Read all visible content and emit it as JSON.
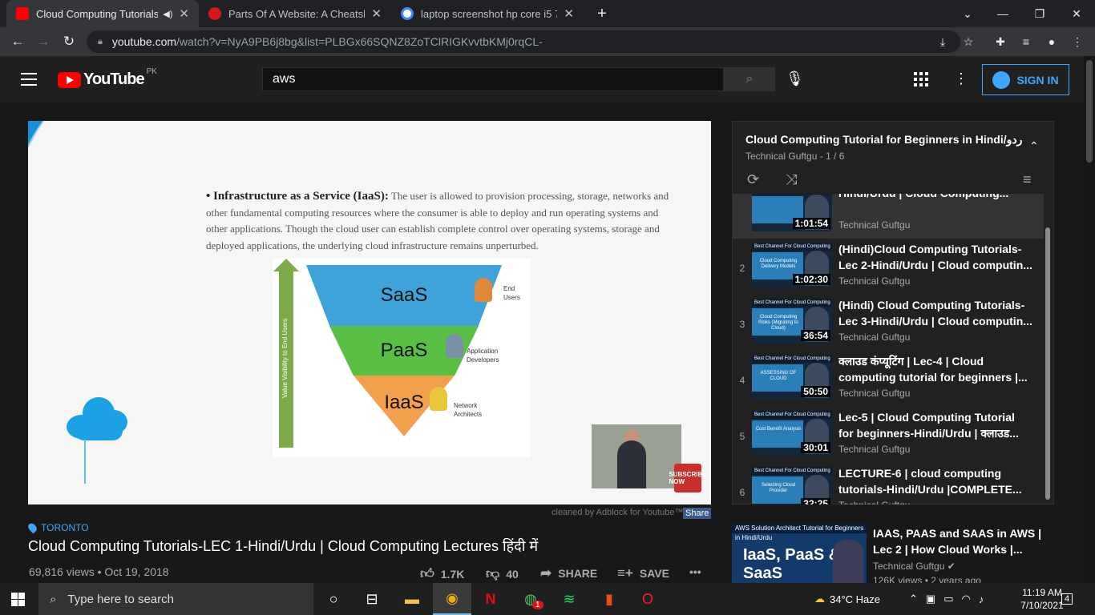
{
  "browser": {
    "tabs": [
      {
        "title": "Cloud Computing Tutorials-L",
        "active": true,
        "favicon_color": "#ff0000"
      },
      {
        "title": "Parts Of A Website: A Cheatsheet",
        "active": false,
        "favicon_color": "#d6171e"
      },
      {
        "title": "laptop screenshot hp core i5 7th",
        "active": false,
        "favicon_color": "#4285f4"
      }
    ],
    "new_tab": "+",
    "url_host": "youtube.com",
    "url_path": "/watch?v=NyA9PB6j8bg&list=PLBGx66SQNZ8ZoTClRIGKvvtbKMj0rqCL-"
  },
  "youtube": {
    "logo_text": "YouTube",
    "country_code": "PK",
    "search_value": "aws",
    "sign_in": "SIGN IN"
  },
  "slide": {
    "heading": "• Infrastructure as a Service (IaaS):",
    "body": "The user is allowed to provision processing, storage, networks and other fundamental computing resources where the consumer is able to deploy and run operating systems and other applications. Though the cloud user can establish complete control over operating systems, storage and deployed applications, the underlying cloud infrastructure remains unperturbed.",
    "arrow_label": "Value Visibility to End Users",
    "layers": [
      "SaaS",
      "PaaS",
      "IaaS"
    ],
    "roles": [
      "End Users",
      "Application Developers",
      "Network Architects"
    ],
    "subscribe": "SUBSCRIBE NOW"
  },
  "player_footer": {
    "adblock": "cleaned by Adblock for Youtube™",
    "share": "Share"
  },
  "video": {
    "location": "TORONTO",
    "title": "Cloud Computing Tutorials-LEC 1-Hindi/Urdu | Cloud Computing Lectures हिंदी में",
    "meta": "69,816 views • Oct 19, 2018",
    "likes": "1.7K",
    "dislikes": "40",
    "share": "SHARE",
    "save": "SAVE"
  },
  "playlist": {
    "title": "Cloud Computing Tutorial for Beginners in Hindi/اردو",
    "subtitle": "Technical Guftgu - 1 / 6",
    "items": [
      {
        "num": "",
        "title": "Hindi/Urdu | Cloud Computing...",
        "channel": "Technical Guftgu",
        "duration": "1:01:54",
        "thumb_caption": "",
        "current": true
      },
      {
        "num": "2",
        "title": "(Hindi)Cloud Computing Tutorials-Lec 2-Hindi/Urdu | Cloud computin...",
        "channel": "Technical Guftgu",
        "duration": "1:02:30",
        "thumb_caption": "Cloud Computing Delivery Models"
      },
      {
        "num": "3",
        "title": "(Hindi) Cloud Computing Tutorials-Lec 3-Hindi/Urdu | Cloud computin...",
        "channel": "Technical Guftgu",
        "duration": "36:54",
        "thumb_caption": "Cloud Computing Risks (Migrating to Cloud)"
      },
      {
        "num": "4",
        "title": "क्लाउड कंप्यूटिंग | Lec-4 | Cloud computing tutorial for beginners |...",
        "channel": "Technical Guftgu",
        "duration": "50:50",
        "thumb_caption": "ASSESSING OF CLOUD"
      },
      {
        "num": "5",
        "title": "Lec-5 | Cloud Computing Tutorial for beginners-Hindi/Urdu | क्लाउड...",
        "channel": "Technical Guftgu",
        "duration": "30:01",
        "thumb_caption": "Cost Benefit Analysis"
      },
      {
        "num": "6",
        "title": "LECTURE-6 | cloud computing tutorials-Hindi/Urdu |COMPLETE...",
        "channel": "Technical Guftgu",
        "duration": "32:25",
        "thumb_caption": "Selecting Cloud Provider"
      }
    ],
    "thumb_band": "Best Channel For Cloud Computing"
  },
  "recommendation": {
    "thumb_bar": "AWS Solution Architect Tutorial for Beginners in Hindi/Urdu",
    "thumb_text": "IaaS, PaaS & SaaS",
    "title": "IAAS, PAAS and SAAS in AWS | Lec 2 | How Cloud Works |...",
    "channel": "Technical Guftgu",
    "views": "126K views • 2 years ago"
  },
  "taskbar": {
    "search_placeholder": "Type here to search",
    "weather": "34°C Haze",
    "time": "11:19 AM",
    "date": "7/10/2021",
    "notification_count": "4",
    "whatsapp_badge": "1"
  }
}
